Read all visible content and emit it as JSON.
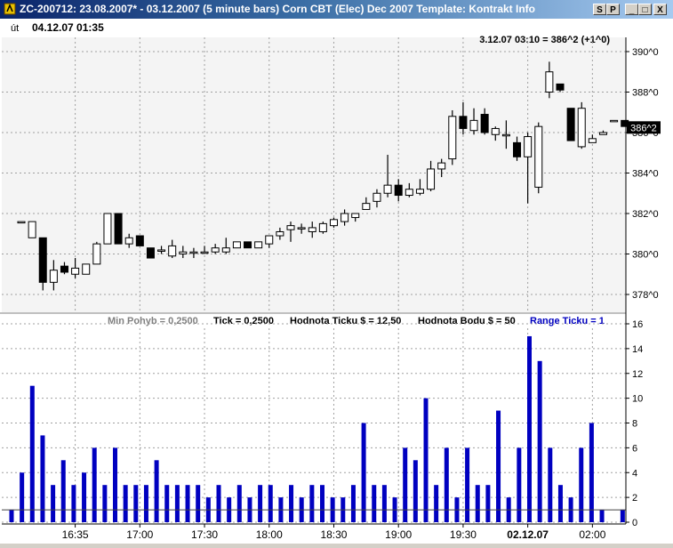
{
  "window": {
    "title": "ZC-200712:  23.08.2007* - 03.12.2007  (5 minute bars)   Corn CBT (Elec) Dec 2007    Template: Kontrakt Info",
    "buttons": {
      "s": "S",
      "p": "P",
      "minimize": "_",
      "maximize": "□",
      "close": "X"
    }
  },
  "header": {
    "day": "út",
    "datetime": "04.12.07 01:35",
    "cursor_readout": "3.12.07 03:10 = 386^2 (+1^0)"
  },
  "info_bar": {
    "min_pohyb": "Min Pohyb = 0,2500",
    "tick": "Tick = 0,2500",
    "hodnota_ticku": "Hodnota Ticku $ = 12,50",
    "hodnota_bodu": "Hodnota Bodu $ = 50",
    "range_ticku": "Range Ticku = 1"
  },
  "colors": {
    "up_candle": "#ffffff",
    "down_candle": "#000000",
    "volume": "#0000c0",
    "range_text": "#0000c0",
    "min_pohyb_text": "#808080",
    "plot_bg": "#f4f4f4",
    "grid": "#a0a0a0"
  },
  "chart_data": [
    {
      "type": "candlestick",
      "y_unit": "cents (quarter-cent fractions as ^0/^2/^4/^6)",
      "y_tick_labels": [
        "378^0",
        "380^0",
        "382^0",
        "384^0",
        "386^0",
        "388^0",
        "390^0"
      ],
      "y_ticks": [
        378,
        380,
        382,
        384,
        386,
        388,
        390
      ],
      "ylim": [
        377,
        391
      ],
      "last_price_label": "386^2",
      "last_price": 386.25,
      "x_tick_labels": [
        "16:35",
        "17:00",
        "17:30",
        "18:00",
        "18:30",
        "19:00",
        "19:30",
        "02.12.07",
        "02:00"
      ],
      "x_tick_bar_index": [
        5,
        11,
        17,
        23,
        29,
        35,
        41,
        47,
        53
      ],
      "grid": true,
      "bars": [
        {
          "o": 381.6,
          "h": 381.6,
          "l": 381.6,
          "c": 381.6
        },
        {
          "o": 380.8,
          "h": 381.6,
          "l": 380.8,
          "c": 381.6
        },
        {
          "o": 380.8,
          "h": 380.8,
          "l": 378.2,
          "c": 378.6
        },
        {
          "o": 378.6,
          "h": 379.7,
          "l": 378.2,
          "c": 379.2
        },
        {
          "o": 379.4,
          "h": 379.6,
          "l": 379.0,
          "c": 379.1
        },
        {
          "o": 379.0,
          "h": 379.8,
          "l": 378.8,
          "c": 379.3
        },
        {
          "o": 379.0,
          "h": 379.5,
          "l": 379.0,
          "c": 379.5
        },
        {
          "o": 379.5,
          "h": 380.6,
          "l": 379.5,
          "c": 380.5
        },
        {
          "o": 380.5,
          "h": 382.0,
          "l": 380.5,
          "c": 382.0
        },
        {
          "o": 382.0,
          "h": 382.0,
          "l": 380.5,
          "c": 380.5
        },
        {
          "o": 380.5,
          "h": 381.0,
          "l": 380.3,
          "c": 380.8
        },
        {
          "o": 380.9,
          "h": 380.9,
          "l": 380.4,
          "c": 380.4
        },
        {
          "o": 380.3,
          "h": 380.3,
          "l": 379.8,
          "c": 379.8
        },
        {
          "o": 380.2,
          "h": 380.4,
          "l": 380.0,
          "c": 380.2
        },
        {
          "o": 379.9,
          "h": 380.7,
          "l": 379.8,
          "c": 380.4
        },
        {
          "o": 380.0,
          "h": 380.4,
          "l": 379.8,
          "c": 380.1
        },
        {
          "o": 380.1,
          "h": 380.3,
          "l": 379.8,
          "c": 380.1
        },
        {
          "o": 380.1,
          "h": 380.4,
          "l": 380.0,
          "c": 380.1
        },
        {
          "o": 380.1,
          "h": 380.5,
          "l": 380.0,
          "c": 380.3
        },
        {
          "o": 380.1,
          "h": 380.8,
          "l": 380.0,
          "c": 380.3
        },
        {
          "o": 380.3,
          "h": 380.6,
          "l": 380.3,
          "c": 380.6
        },
        {
          "o": 380.6,
          "h": 380.6,
          "l": 380.3,
          "c": 380.3
        },
        {
          "o": 380.3,
          "h": 380.6,
          "l": 380.3,
          "c": 380.6
        },
        {
          "o": 380.5,
          "h": 380.9,
          "l": 380.3,
          "c": 380.9
        },
        {
          "o": 380.9,
          "h": 381.3,
          "l": 380.7,
          "c": 381.1
        },
        {
          "o": 381.2,
          "h": 381.6,
          "l": 380.6,
          "c": 381.4
        },
        {
          "o": 381.3,
          "h": 381.5,
          "l": 381.0,
          "c": 381.3
        },
        {
          "o": 381.1,
          "h": 381.6,
          "l": 380.8,
          "c": 381.3
        },
        {
          "o": 381.1,
          "h": 381.6,
          "l": 381.0,
          "c": 381.5
        },
        {
          "o": 381.4,
          "h": 381.8,
          "l": 381.3,
          "c": 381.7
        },
        {
          "o": 381.6,
          "h": 382.2,
          "l": 381.4,
          "c": 382.0
        },
        {
          "o": 381.8,
          "h": 382.0,
          "l": 381.6,
          "c": 382.0
        },
        {
          "o": 382.2,
          "h": 382.8,
          "l": 382.2,
          "c": 382.5
        },
        {
          "o": 382.6,
          "h": 383.2,
          "l": 382.3,
          "c": 383.0
        },
        {
          "o": 383.0,
          "h": 384.9,
          "l": 382.8,
          "c": 383.4
        },
        {
          "o": 383.4,
          "h": 383.7,
          "l": 382.6,
          "c": 382.9
        },
        {
          "o": 382.9,
          "h": 383.5,
          "l": 382.8,
          "c": 383.2
        },
        {
          "o": 383.0,
          "h": 383.7,
          "l": 382.9,
          "c": 383.2
        },
        {
          "o": 383.2,
          "h": 384.6,
          "l": 383.1,
          "c": 384.2
        },
        {
          "o": 384.2,
          "h": 384.7,
          "l": 383.8,
          "c": 384.5
        },
        {
          "o": 384.7,
          "h": 387.1,
          "l": 384.4,
          "c": 386.8
        },
        {
          "o": 386.8,
          "h": 387.5,
          "l": 385.9,
          "c": 386.2
        },
        {
          "o": 386.1,
          "h": 387.2,
          "l": 385.9,
          "c": 386.6
        },
        {
          "o": 386.9,
          "h": 387.2,
          "l": 385.9,
          "c": 386.0
        },
        {
          "o": 385.9,
          "h": 386.3,
          "l": 385.6,
          "c": 386.2
        },
        {
          "o": 385.9,
          "h": 386.6,
          "l": 385.2,
          "c": 385.9
        },
        {
          "o": 385.5,
          "h": 385.8,
          "l": 384.6,
          "c": 384.8
        },
        {
          "o": 384.8,
          "h": 386.0,
          "l": 382.5,
          "c": 385.8
        },
        {
          "o": 383.3,
          "h": 386.5,
          "l": 383.0,
          "c": 386.3
        },
        {
          "o": 388.0,
          "h": 389.5,
          "l": 387.7,
          "c": 389.0
        },
        {
          "o": 388.4,
          "h": 388.4,
          "l": 388.0,
          "c": 388.1
        },
        {
          "o": 387.2,
          "h": 387.2,
          "l": 385.6,
          "c": 385.6
        },
        {
          "o": 385.3,
          "h": 387.5,
          "l": 385.2,
          "c": 387.2
        },
        {
          "o": 385.5,
          "h": 385.9,
          "l": 385.5,
          "c": 385.7
        },
        {
          "o": 385.9,
          "h": 386.1,
          "l": 385.9,
          "c": 386.0
        },
        {
          "o": 386.6,
          "h": 386.6,
          "l": 386.6,
          "c": 386.6
        },
        {
          "o": 386.6,
          "h": 386.6,
          "l": 386.3,
          "c": 386.3
        }
      ]
    },
    {
      "type": "bar",
      "y_ticks": [
        0,
        2,
        4,
        6,
        8,
        10,
        12,
        14,
        16
      ],
      "ylim": [
        0,
        16.5
      ],
      "reference_line": 1,
      "values": [
        1,
        4,
        11,
        7,
        3,
        5,
        3,
        4,
        6,
        3,
        6,
        3,
        3,
        3,
        5,
        3,
        3,
        3,
        3,
        2,
        3,
        2,
        3,
        2,
        3,
        3,
        2,
        3,
        2,
        3,
        3,
        2,
        2,
        3,
        8,
        3,
        3,
        2,
        6,
        5,
        10,
        3,
        6,
        2,
        6,
        3,
        3,
        9,
        2,
        6,
        15,
        13,
        6,
        3,
        2,
        6,
        8,
        1,
        0,
        1
      ]
    }
  ]
}
